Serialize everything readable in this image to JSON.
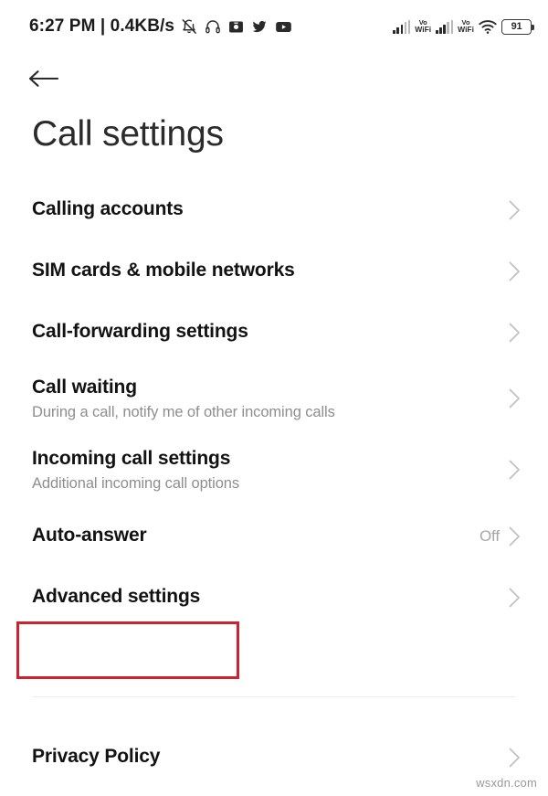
{
  "status_bar": {
    "clock": "6:27 PM | 0.4KB/s",
    "notification_icons": [
      "bell-off-icon",
      "headphones-icon",
      "screenshot-icon",
      "twitter-icon",
      "youtube-icon"
    ],
    "signal_label_1": "Vo",
    "signal_label_2": "WiFi",
    "signal_label_3": "Vo",
    "signal_label_4": "WiFi",
    "battery_percent": "91"
  },
  "header": {
    "back_icon": "arrow-left-icon",
    "title": "Call settings"
  },
  "settings": [
    {
      "title": "Calling accounts",
      "subtitle": "",
      "value": ""
    },
    {
      "title": "SIM cards & mobile networks",
      "subtitle": "",
      "value": ""
    },
    {
      "title": "Call-forwarding settings",
      "subtitle": "",
      "value": ""
    },
    {
      "title": "Call waiting",
      "subtitle": "During a call, notify me of other incoming calls",
      "value": ""
    },
    {
      "title": "Incoming call settings",
      "subtitle": "Additional incoming call options",
      "value": ""
    },
    {
      "title": "Auto-answer",
      "subtitle": "",
      "value": "Off"
    },
    {
      "title": "Advanced settings",
      "subtitle": "",
      "value": ""
    }
  ],
  "footer": {
    "privacy_policy": "Privacy Policy"
  },
  "annotation": {
    "target": "Advanced settings",
    "color": "#cf2230"
  },
  "watermark": "wsxdn.com",
  "colors": {
    "background": "#ffffff",
    "title_text": "#2b2b2b",
    "row_title": "#121212",
    "row_subtitle": "#8e8e8e",
    "row_value": "#a6a6a6",
    "chevron": "#c2c2c2",
    "divider": "#ececec",
    "annotation_red": "#cf2230"
  }
}
